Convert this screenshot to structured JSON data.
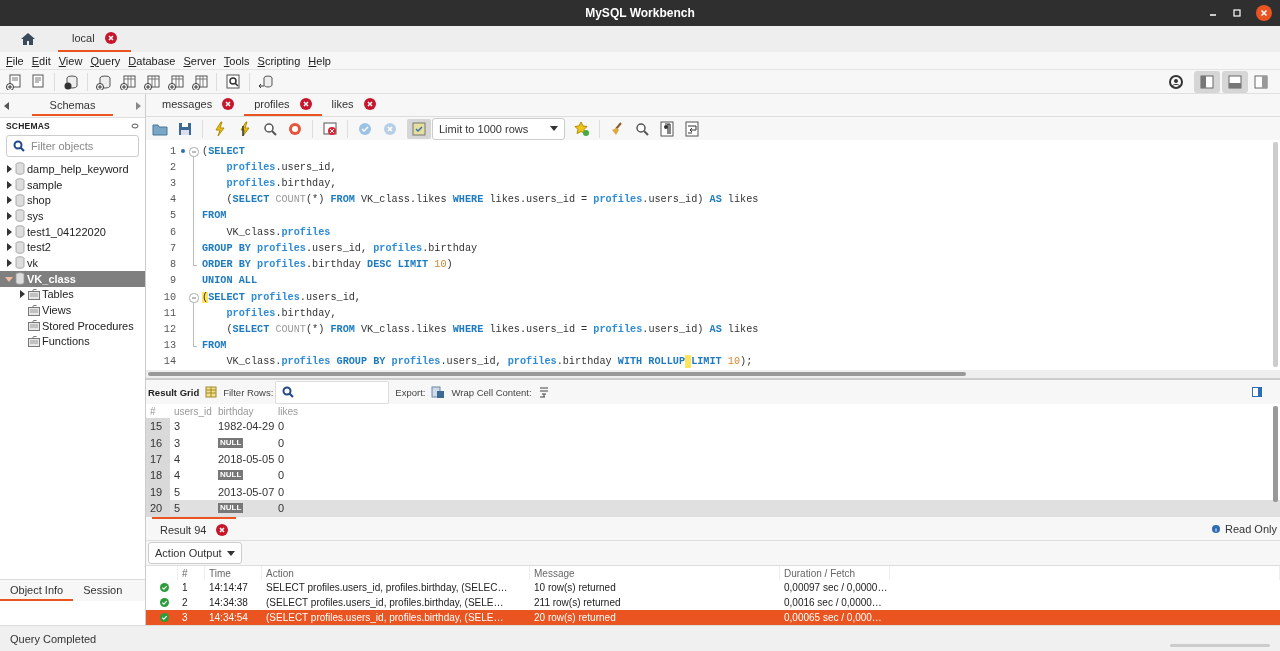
{
  "window": {
    "title": "MySQL Workbench"
  },
  "connection_tabs": [
    {
      "label": "local",
      "selected": true
    }
  ],
  "menu": [
    "File",
    "Edit",
    "View",
    "Query",
    "Database",
    "Server",
    "Tools",
    "Scripting",
    "Help"
  ],
  "sidebar": {
    "title": "Schemas",
    "heading": "SCHEMAS",
    "filter": {
      "placeholder": "Filter objects"
    },
    "schemas": [
      {
        "name": "damp_help_keyword",
        "expanded": false,
        "selected": false
      },
      {
        "name": "sample",
        "expanded": false,
        "selected": false
      },
      {
        "name": "shop",
        "expanded": false,
        "selected": false
      },
      {
        "name": "sys",
        "expanded": false,
        "selected": false
      },
      {
        "name": "test1_04122020",
        "expanded": false,
        "selected": false
      },
      {
        "name": "test2",
        "expanded": false,
        "selected": false
      },
      {
        "name": "vk",
        "expanded": false,
        "selected": false
      },
      {
        "name": "VK_class",
        "expanded": true,
        "selected": true,
        "children": [
          {
            "name": "Tables",
            "expandable": true
          },
          {
            "name": "Views",
            "expandable": false
          },
          {
            "name": "Stored Procedures",
            "expandable": false
          },
          {
            "name": "Functions",
            "expandable": false
          }
        ]
      }
    ],
    "bottom_tabs": [
      {
        "label": "Object Info",
        "selected": true
      },
      {
        "label": "Session",
        "selected": false
      }
    ]
  },
  "editor": {
    "tabs": [
      {
        "label": "messages",
        "selected": false
      },
      {
        "label": "profiles",
        "selected": true
      },
      {
        "label": "likes",
        "selected": false
      }
    ],
    "limit": "Limit to 1000 rows",
    "lines": [
      {
        "number": "1",
        "marker": true,
        "kind": "fold_start",
        "tokens": [
          {
            "kind": "plain",
            "text": "("
          },
          {
            "kind": "keyword",
            "text": "SELECT"
          }
        ]
      },
      {
        "number": "2",
        "marker": false,
        "kind": "fold_inside",
        "tokens": [
          {
            "kind": "table",
            "text": "    profiles"
          },
          {
            "kind": "plain",
            "text": ".users_id,"
          }
        ]
      },
      {
        "number": "3",
        "marker": false,
        "kind": "fold_inside",
        "tokens": [
          {
            "kind": "table",
            "text": "    profiles"
          },
          {
            "kind": "plain",
            "text": ".birthday,"
          }
        ]
      },
      {
        "number": "4",
        "marker": false,
        "kind": "fold_inside",
        "tokens": [
          {
            "kind": "plain",
            "text": "    ("
          },
          {
            "kind": "keyword",
            "text": "SELECT "
          },
          {
            "kind": "function",
            "text": "COUNT"
          },
          {
            "kind": "plain",
            "text": "(*) "
          },
          {
            "kind": "keyword",
            "text": "FROM"
          },
          {
            "kind": "plain",
            "text": " VK_class.likes "
          },
          {
            "kind": "keyword",
            "text": "WHERE"
          },
          {
            "kind": "plain",
            "text": " likes.users_id = "
          },
          {
            "kind": "table",
            "text": "profiles"
          },
          {
            "kind": "plain",
            "text": ".users_id) "
          },
          {
            "kind": "keyword",
            "text": "AS"
          },
          {
            "kind": "plain",
            "text": " likes"
          }
        ]
      },
      {
        "number": "5",
        "marker": false,
        "kind": "fold_inside",
        "tokens": [
          {
            "kind": "keyword",
            "text": "FROM"
          }
        ]
      },
      {
        "number": "6",
        "marker": false,
        "kind": "fold_inside",
        "tokens": [
          {
            "kind": "plain",
            "text": "    VK_class."
          },
          {
            "kind": "table",
            "text": "profiles"
          }
        ]
      },
      {
        "number": "7",
        "marker": false,
        "kind": "fold_inside",
        "tokens": [
          {
            "kind": "keyword",
            "text": "GROUP BY "
          },
          {
            "kind": "table",
            "text": "profiles"
          },
          {
            "kind": "plain",
            "text": ".users_id, "
          },
          {
            "kind": "table",
            "text": "profiles"
          },
          {
            "kind": "plain",
            "text": ".birthday"
          }
        ]
      },
      {
        "number": "8",
        "marker": false,
        "kind": "fold_end",
        "tokens": [
          {
            "kind": "keyword",
            "text": "ORDER BY "
          },
          {
            "kind": "table",
            "text": "profiles"
          },
          {
            "kind": "plain",
            "text": ".birthday "
          },
          {
            "kind": "keyword",
            "text": "DESC LIMIT "
          },
          {
            "kind": "number",
            "text": "10"
          },
          {
            "kind": "plain",
            "text": ")"
          }
        ]
      },
      {
        "number": "9",
        "marker": false,
        "kind": "plain",
        "tokens": [
          {
            "kind": "keyword",
            "text": "UNION ALL"
          }
        ]
      },
      {
        "number": "10",
        "marker": false,
        "kind": "fold_start",
        "tokens": [
          {
            "kind": "match",
            "text": "("
          },
          {
            "kind": "keyword",
            "text": "SELECT "
          },
          {
            "kind": "table",
            "text": "profiles"
          },
          {
            "kind": "plain",
            "text": ".users_id,"
          }
        ]
      },
      {
        "number": "11",
        "marker": false,
        "kind": "fold_inside",
        "tokens": [
          {
            "kind": "table",
            "text": "    profiles"
          },
          {
            "kind": "plain",
            "text": ".birthday,"
          }
        ]
      },
      {
        "number": "12",
        "marker": false,
        "kind": "fold_inside",
        "tokens": [
          {
            "kind": "plain",
            "text": "    ("
          },
          {
            "kind": "keyword",
            "text": "SELECT "
          },
          {
            "kind": "function",
            "text": "COUNT"
          },
          {
            "kind": "plain",
            "text": "(*) "
          },
          {
            "kind": "keyword",
            "text": "FROM"
          },
          {
            "kind": "plain",
            "text": " VK_class.likes "
          },
          {
            "kind": "keyword",
            "text": "WHERE"
          },
          {
            "kind": "plain",
            "text": " likes.users_id = "
          },
          {
            "kind": "table",
            "text": "profiles"
          },
          {
            "kind": "plain",
            "text": ".users_id) "
          },
          {
            "kind": "keyword",
            "text": "AS"
          },
          {
            "kind": "plain",
            "text": " likes"
          }
        ]
      },
      {
        "number": "13",
        "marker": false,
        "kind": "fold_end",
        "tokens": [
          {
            "kind": "keyword",
            "text": "FROM"
          }
        ]
      },
      {
        "number": "14",
        "marker": false,
        "kind": "plain",
        "tokens": [
          {
            "kind": "plain",
            "text": "    VK_class."
          },
          {
            "kind": "table",
            "text": "profiles"
          },
          {
            "kind": "keyword",
            "text": " GROUP BY "
          },
          {
            "kind": "table",
            "text": "profiles"
          },
          {
            "kind": "plain",
            "text": ".users_id, "
          },
          {
            "kind": "table",
            "text": "profiles"
          },
          {
            "kind": "plain",
            "text": ".birthday "
          },
          {
            "kind": "keyword",
            "text": "WITH ROLLUP"
          },
          {
            "kind": "keyword",
            "text": "LIMIT ",
            "cursor_before": true
          },
          {
            "kind": "number",
            "text": "10"
          },
          {
            "kind": "plain",
            "text": ");"
          }
        ]
      }
    ]
  },
  "results": {
    "title": "Result Grid",
    "filter_label": "Filter Rows:",
    "export_label": "Export:",
    "wrap_label": "Wrap Cell Content:",
    "columns": [
      "#",
      "users_id",
      "birthday",
      "likes"
    ],
    "rows": [
      {
        "number": "15",
        "users_id": "3",
        "birthday": "1982-04-29",
        "birthday_null": false,
        "likes": "0",
        "selected": false
      },
      {
        "number": "16",
        "users_id": "3",
        "birthday": "NULL",
        "birthday_null": true,
        "likes": "0",
        "selected": false
      },
      {
        "number": "17",
        "users_id": "4",
        "birthday": "2018-05-05",
        "birthday_null": false,
        "likes": "0",
        "selected": false
      },
      {
        "number": "18",
        "users_id": "4",
        "birthday": "NULL",
        "birthday_null": true,
        "likes": "0",
        "selected": false
      },
      {
        "number": "19",
        "users_id": "5",
        "birthday": "2013-05-07",
        "birthday_null": false,
        "likes": "0",
        "selected": false
      },
      {
        "number": "20",
        "users_id": "5",
        "birthday": "NULL",
        "birthday_null": true,
        "likes": "0",
        "selected": true
      }
    ]
  },
  "result_tabs": [
    {
      "label": "Result 94",
      "selected": true
    }
  ],
  "read_only": "Read Only",
  "output": {
    "mode": "Action Output",
    "columns": [
      "#",
      "Time",
      "Action",
      "Message",
      "Duration / Fetch"
    ],
    "rows": [
      {
        "kind": "ok",
        "number": "1",
        "time": "14:14:47",
        "action": "SELECT    profiles.users_id,    profiles.birthday,    (SELEC…",
        "message": "10 row(s) returned",
        "duration": "0,00097 sec / 0,0000…",
        "selected": false
      },
      {
        "kind": "ok",
        "number": "2",
        "time": "14:34:38",
        "action": "(SELECT    profiles.users_id,    profiles.birthday,    (SELE…",
        "message": "211 row(s) returned",
        "duration": "0,0016 sec / 0,0000…",
        "selected": false
      },
      {
        "kind": "ok",
        "number": "3",
        "time": "14:34:54",
        "action": "(SELECT    profiles.users_id,    profiles.birthday,    (SELE…",
        "message": "20 row(s) returned",
        "duration": "0,00065 sec / 0,000…",
        "selected": true
      }
    ]
  },
  "status_bar": "Query Completed"
}
